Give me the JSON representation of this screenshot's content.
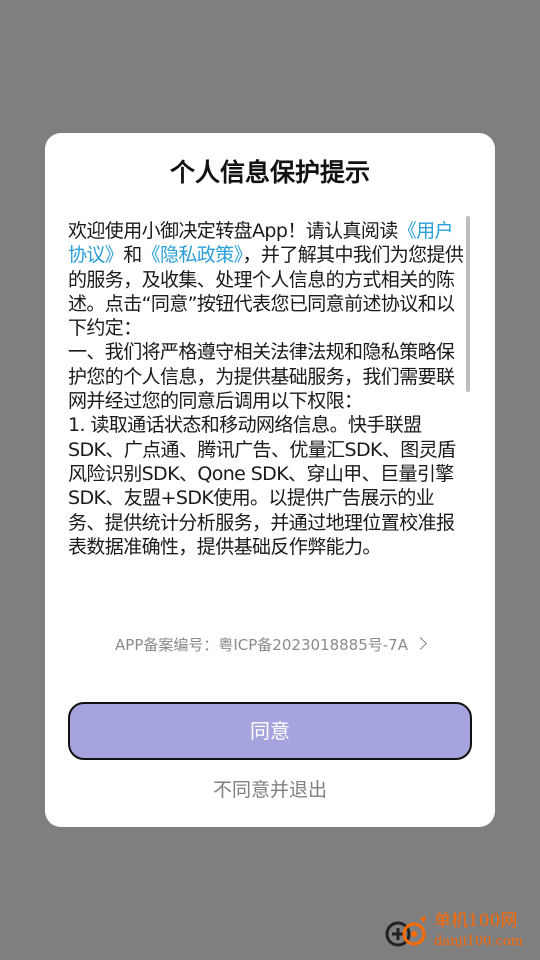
{
  "dialog": {
    "title": "个人信息保护提示",
    "content": {
      "intro": "欢迎使用小御决定转盘App！请认真阅读",
      "link_user_agreement": "《用户协议》",
      "and": "和",
      "link_privacy_policy": "《隐私政策》",
      "after_links": "，并了解其中我们为您提供的服务，及收集、处理个人信息的方式相关的陈述。点击“同意”按钮代表您已同意前述协议和以下约定：",
      "para1": "一、我们将严格遵守相关法律法规和隐私策略保护您的个人信息，为提供基础服务，我们需要联网并经过您的同意后调用以下权限：",
      "para2": "1. 读取通话状态和移动网络信息。快手联盟SDK、广点通、腾讯广告、优量汇SDK、图灵盾风险识别SDK、Qone SDK、穿山甲、巨量引擎SDK、友盟+SDK使用。以提供广告展示的业务、提供统计分析服务，并通过地理位置校准报表数据准确性，提供基础反作弊能力。"
    },
    "icp_label": "APP备案编号：粤ICP备2023018885号-7A",
    "agree_button": "同意",
    "disagree_button": "不同意并退出"
  },
  "watermark": {
    "name": "单机100网",
    "domain": "danji100.com"
  },
  "icons": {
    "icp_chevron": "chevron-right-icon",
    "watermark_logo": "gamepad-logo-icon"
  },
  "colors": {
    "overlay": "#7f7f7f",
    "link": "#2a9fd8",
    "agree_button": "#a6a4de",
    "watermark": "#ff6a00"
  }
}
